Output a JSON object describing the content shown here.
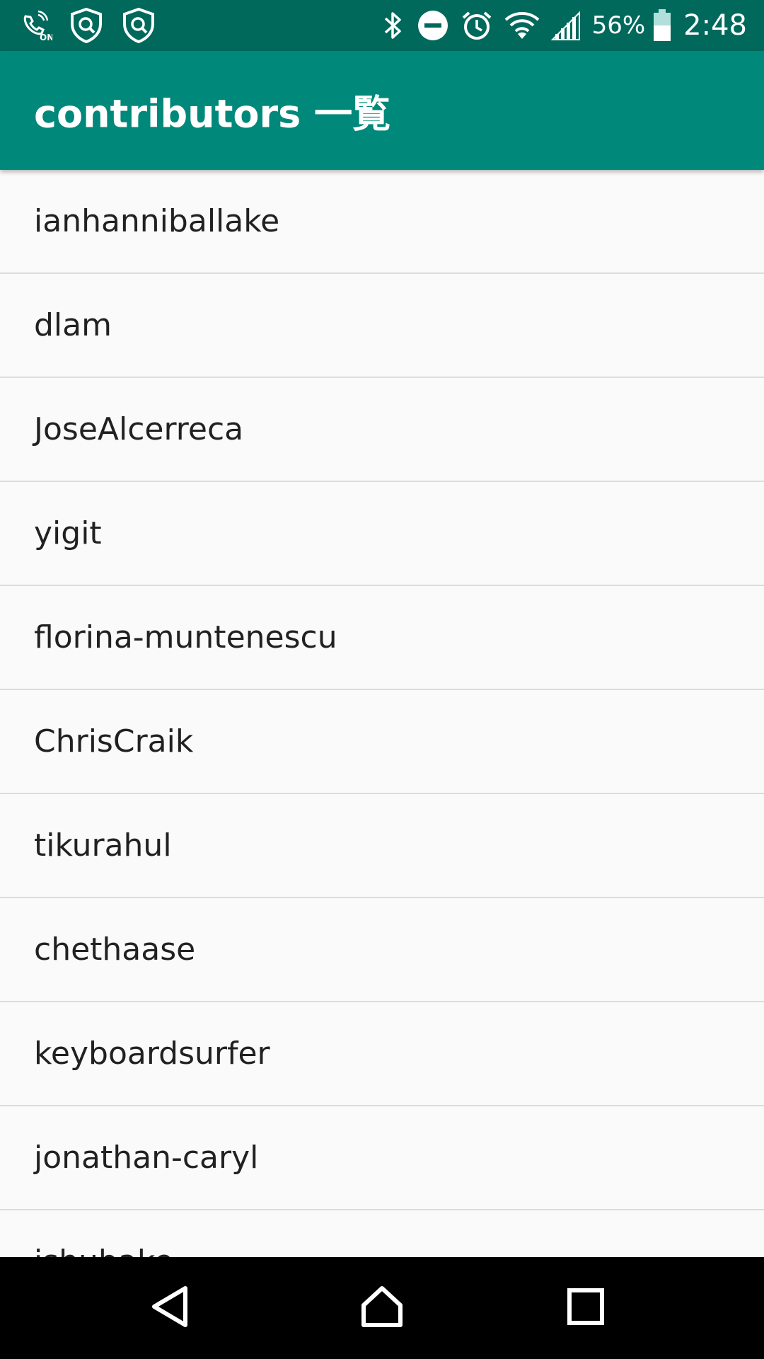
{
  "status_bar": {
    "battery_percent": "56%",
    "battery_level": 0.56,
    "time": "2:48",
    "icons": [
      "wifi-calling-icon",
      "shield-search-icon",
      "shield-search-icon",
      "bluetooth-icon",
      "do-not-disturb-icon",
      "alarm-icon",
      "wifi-icon",
      "cell-signal-icon",
      "battery-icon"
    ],
    "wifi_calling_label": "ON"
  },
  "app_bar": {
    "title": "contributors 一覧",
    "color": "#00897b"
  },
  "contributors": [
    "ianhanniballake",
    "dlam",
    "JoseAlcerreca",
    "yigit",
    "florina-muntenescu",
    "ChrisCraik",
    "tikurahul",
    "chethaase",
    "keyboardsurfer",
    "jonathan-caryl",
    "jshubake"
  ],
  "nav_bar": {
    "icons": [
      "back-icon",
      "home-icon",
      "recents-icon"
    ]
  }
}
